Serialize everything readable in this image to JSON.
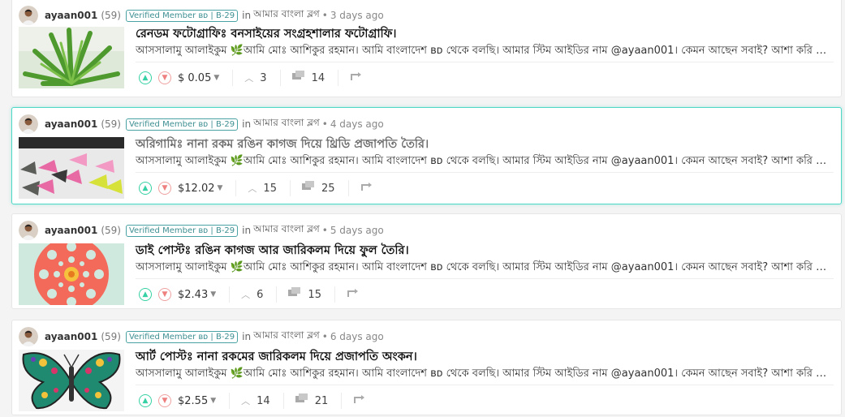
{
  "posts": [
    {
      "author": "ayaan001",
      "reputation": "(59)",
      "badge": "Verified Member ʙᴅ | B-29",
      "in_word": "in",
      "community": "আমার বাংলা ব্লগ",
      "dot": "•",
      "time": "3 days ago",
      "title": "রেনডম ফটোগ্রাফিঃ বনসাইয়ের সংগ্রহশালার ফটোগ্রাফি।",
      "body": "আসসালামু আলাইকুম 🌿আমি মোঃ আশিকুর রহমান। আমি বাংলাদেশ ʙᴅ থেকে বলছি। আমার স্টিম আইডির নাম @ayaan001। কেমন আছেন সবাই? আশা করি সবাই ভালো আছেন।",
      "payout": "$ 0.05",
      "votes": "3",
      "comments": "14"
    },
    {
      "author": "ayaan001",
      "reputation": "(59)",
      "badge": "Verified Member ʙᴅ | B-29",
      "in_word": "in",
      "community": "আমার বাংলা ব্লগ",
      "dot": "•",
      "time": "4 days ago",
      "title": "অরিগামিঃ নানা রকম রঙিন কাগজ দিয়ে থ্রিডি প্রজাপতি তৈরি।",
      "body": "আসসালামু আলাইকুম 🌿আমি মোঃ আশিকুর রহমান। আমি বাংলাদেশ ʙᴅ থেকে বলছি। আমার স্টিম আইডির নাম @ayaan001। কেমন আছেন সবাই? আশা করি সবাই ভালো আছেন।",
      "payout": "$12.02",
      "votes": "15",
      "comments": "25"
    },
    {
      "author": "ayaan001",
      "reputation": "(59)",
      "badge": "Verified Member ʙᴅ | B-29",
      "in_word": "in",
      "community": "আমার বাংলা ব্লগ",
      "dot": "•",
      "time": "5 days ago",
      "title": "ডাই পোস্টঃ রঙিন কাগজ আর জারিকলম দিয়ে ফুল তৈরি।",
      "body": "আসসালামু আলাইকুম 🌿আমি মোঃ আশিকুর রহমান। আমি বাংলাদেশ ʙᴅ থেকে বলছি। আমার স্টিম আইডির নাম @ayaan001। কেমন আছেন সবাই? আশা করি সবাই ভালো আছেন।",
      "payout": "$2.43",
      "votes": "6",
      "comments": "15"
    },
    {
      "author": "ayaan001",
      "reputation": "(59)",
      "badge": "Verified Member ʙᴅ | B-29",
      "in_word": "in",
      "community": "আমার বাংলা ব্লগ",
      "dot": "•",
      "time": "6 days ago",
      "title": "আর্ট পোস্টঃ নানা রকমের জারিকলম দিয়ে প্রজাপতি অংকন।",
      "body": "আসসালামু আলাইকুম 🌿আমি মোঃ আশিকুর রহমান। আমি বাংলাদেশ ʙᴅ থেকে বলছি। আমার স্টিম আইডির নাম @ayaan001। কেমন আছেন সবাই? আশা করি সবাই ভালো আছেন।",
      "payout": "$2.55",
      "votes": "14",
      "comments": "21"
    }
  ],
  "icons": {
    "upvote": "upvote-icon",
    "downvote": "downvote-icon",
    "payout_caret": "caret-down-icon",
    "voters": "chevron-up-icon",
    "comments": "comments-icon",
    "reblog": "reblog-icon"
  },
  "colors": {
    "upvote": "#36d1a4",
    "downvote": "#ee8080",
    "badge": "#3e8f92",
    "highlight_border": "#4fd8c5"
  }
}
